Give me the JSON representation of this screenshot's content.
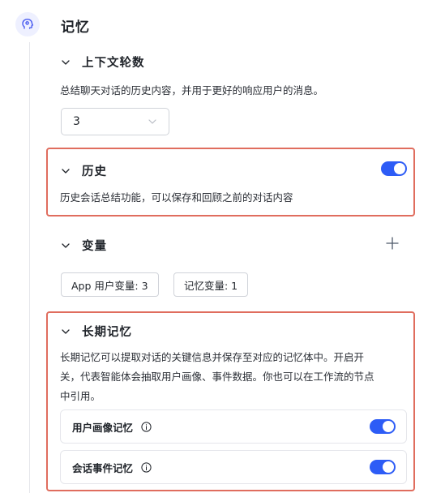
{
  "title": "记忆",
  "context": {
    "title": "上下文轮数",
    "description": "总结聊天对话的历史内容，并用于更好的响应用户的消息。",
    "select_value": "3"
  },
  "history": {
    "title": "历史",
    "description": "历史会话总结功能，可以保存和回顾之前的对话内容",
    "enabled": true
  },
  "variables": {
    "title": "变量",
    "chips": [
      "App 用户变量: 3",
      "记忆变量: 1"
    ]
  },
  "long_term": {
    "title": "长期记忆",
    "description_lines": [
      "长期记忆可以提取对话的关键信息并保存至对应的记忆体中。开启开",
      "关，代表智能体会抽取用户画像、事件数据。你也可以在工作流的节点",
      "中引用。"
    ],
    "items": [
      {
        "label": "用户画像记忆",
        "enabled": true
      },
      {
        "label": "会话事件记忆",
        "enabled": true
      }
    ]
  },
  "colors": {
    "accent": "#2d5cf6",
    "highlight": "#e06d5e"
  },
  "icons": {
    "memory": "brain-head-icon",
    "collapse": "chevron-down-icon",
    "add": "plus-icon",
    "info": "info-circle-icon"
  }
}
